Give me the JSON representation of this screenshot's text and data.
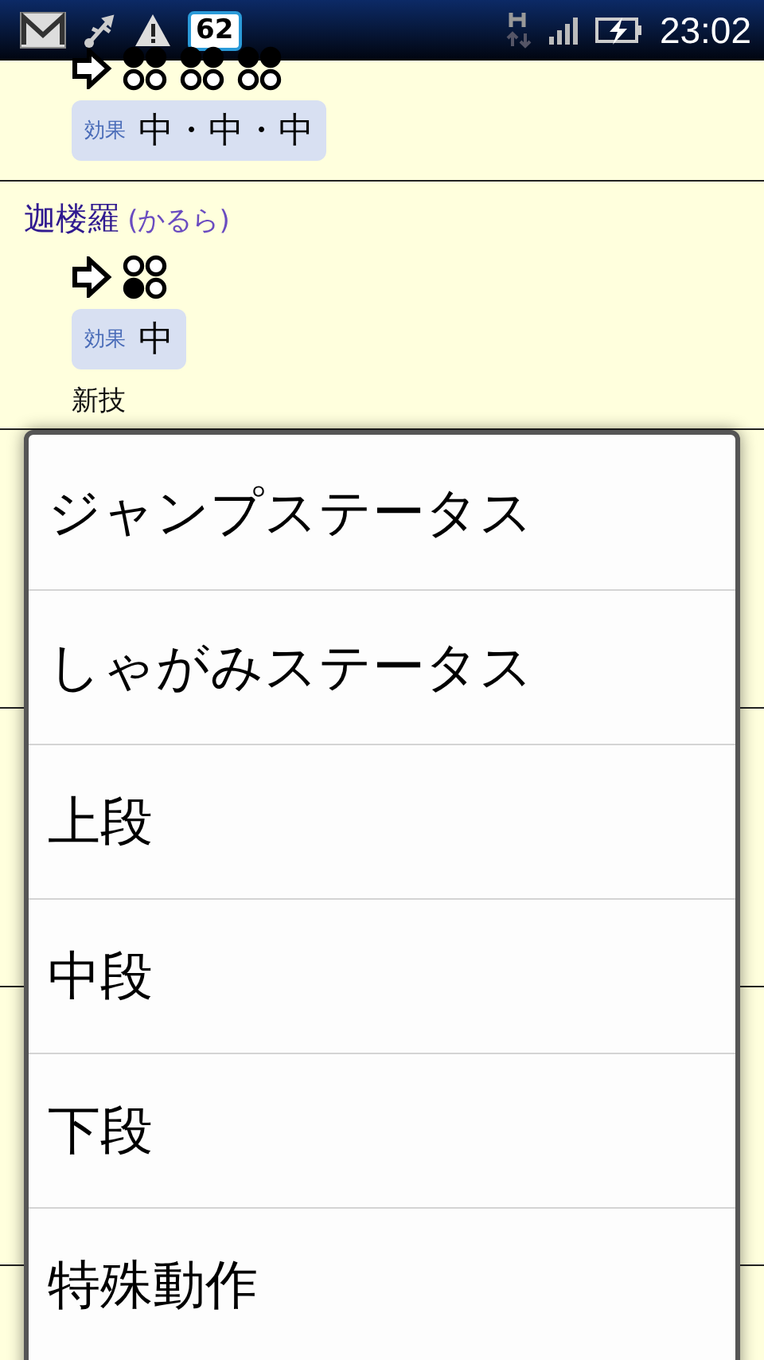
{
  "status_bar": {
    "notification_count": "62",
    "time": "23:02"
  },
  "moves": [
    {
      "commands": [
        {
          "filled": [
            true,
            true,
            false,
            false
          ]
        },
        {
          "filled": [
            true,
            true,
            false,
            false
          ]
        },
        {
          "filled": [
            true,
            true,
            false,
            false
          ]
        }
      ],
      "effect_label": "効果",
      "effect": "中・中・中"
    },
    {
      "name": "迦楼羅",
      "reading": "(かるら)",
      "commands": [
        {
          "filled": [
            false,
            false,
            true,
            false
          ]
        }
      ],
      "effect_label": "効果",
      "effect": "中",
      "note": "新技"
    }
  ],
  "menu": {
    "items": [
      {
        "label": "ジャンプステータス"
      },
      {
        "label": "しゃがみステータス"
      },
      {
        "label": "上段"
      },
      {
        "label": "中段"
      },
      {
        "label": "下段"
      },
      {
        "label": "特殊動作"
      }
    ]
  }
}
